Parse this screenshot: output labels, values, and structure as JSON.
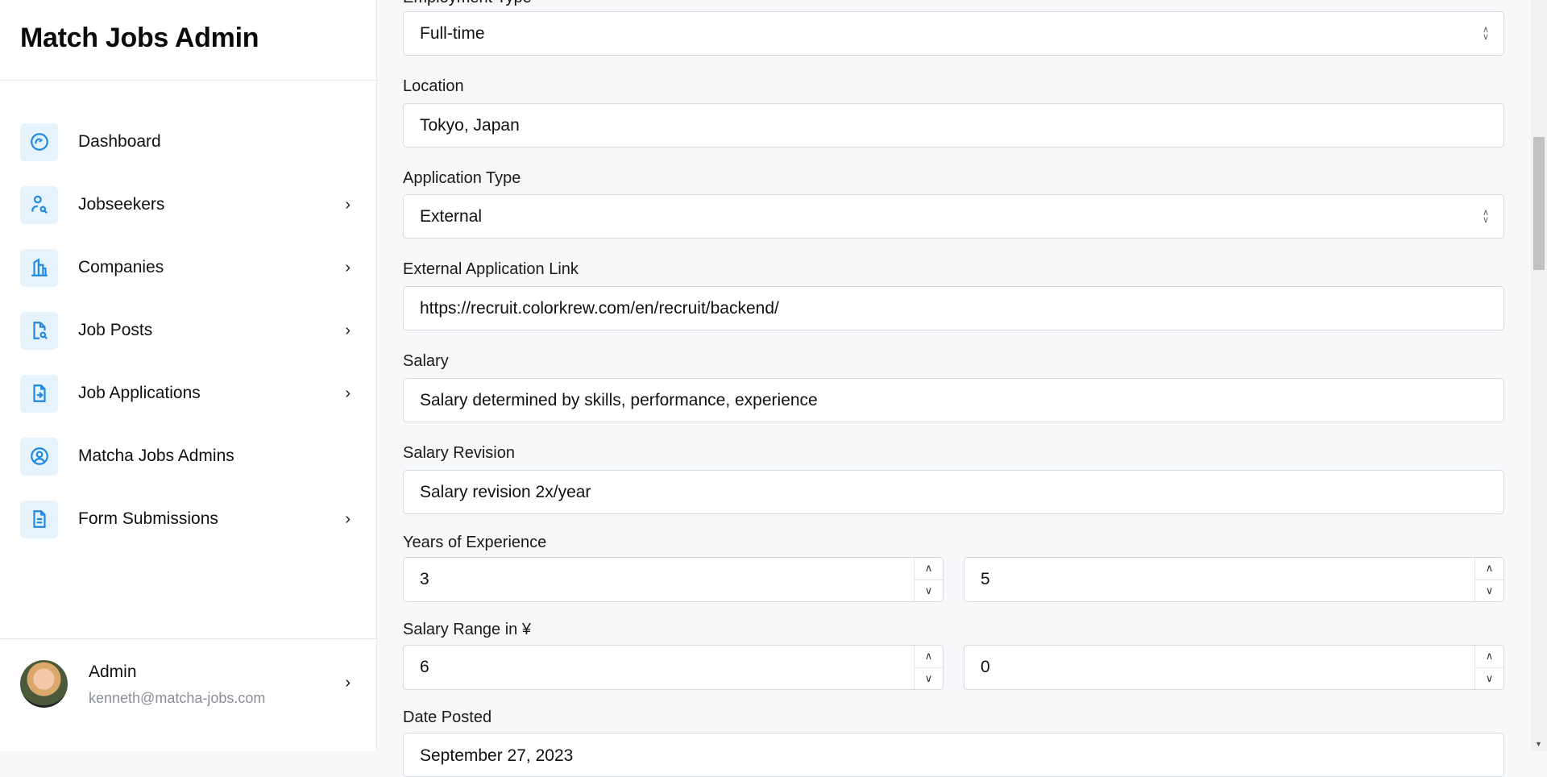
{
  "sidebar": {
    "title": "Match Jobs Admin",
    "items": [
      {
        "label": "Dashboard",
        "icon": "gauge-icon",
        "has_chevron": false
      },
      {
        "label": "Jobseekers",
        "icon": "user-search-icon",
        "has_chevron": true
      },
      {
        "label": "Companies",
        "icon": "building-icon",
        "has_chevron": true
      },
      {
        "label": "Job Posts",
        "icon": "file-search-icon",
        "has_chevron": true
      },
      {
        "label": "Job Applications",
        "icon": "file-arrow-icon",
        "has_chevron": true
      },
      {
        "label": "Matcha Jobs Admins",
        "icon": "user-circle-icon",
        "has_chevron": false
      },
      {
        "label": "Form Submissions",
        "icon": "document-icon",
        "has_chevron": true
      }
    ],
    "user": {
      "name": "Admin",
      "email": "kenneth@matcha-jobs.com"
    }
  },
  "form": {
    "employment_type": {
      "label": "Employment Type",
      "value": "Full-time"
    },
    "location": {
      "label": "Location",
      "value": "Tokyo, Japan"
    },
    "application_type": {
      "label": "Application Type",
      "value": "External"
    },
    "external_link": {
      "label": "External Application Link",
      "value": "https://recruit.colorkrew.com/en/recruit/backend/"
    },
    "salary": {
      "label": "Salary",
      "value": "Salary determined by skills, performance, experience"
    },
    "salary_revision": {
      "label": "Salary Revision",
      "value": "Salary revision 2x/year"
    },
    "years_experience": {
      "label": "Years of Experience",
      "min": "3",
      "max": "5"
    },
    "salary_range": {
      "label": "Salary Range in ¥",
      "min": "6",
      "max": "0"
    },
    "date_posted": {
      "label": "Date Posted",
      "value": "September 27, 2023"
    }
  },
  "colors": {
    "accent": "#1e88e5",
    "icon_bg": "#e6f3fd",
    "page_bg": "#f7f8fa"
  }
}
